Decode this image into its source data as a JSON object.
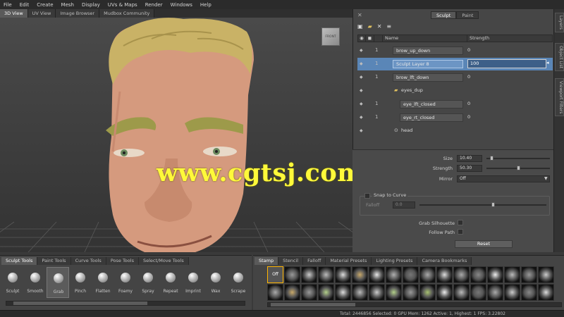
{
  "menubar": [
    "File",
    "Edit",
    "Create",
    "Mesh",
    "Display",
    "UVs & Maps",
    "Render",
    "Windows",
    "Help"
  ],
  "viewport_tabs": [
    {
      "label": "3D View",
      "active": true
    },
    {
      "label": "UV View",
      "active": false
    },
    {
      "label": "Image Browser",
      "active": false
    },
    {
      "label": "Mudbox Community",
      "active": false
    }
  ],
  "view_cube": "FRONT",
  "watermark": "www.cgtsj.com",
  "panel_tabs": [
    {
      "label": "Sculpt",
      "active": true
    },
    {
      "label": "Paint",
      "active": false
    }
  ],
  "layers": {
    "header": [
      "Name",
      "Strength"
    ],
    "rows": [
      {
        "name": "brow_up_down",
        "value": "0",
        "indent": 0,
        "selected": false,
        "lock": "1"
      },
      {
        "name": "Sculpt Layer 8",
        "value": "100",
        "indent": 0,
        "selected": true,
        "lock": "1"
      },
      {
        "name": "brow_lft_down",
        "value": "0",
        "indent": 0,
        "selected": false,
        "lock": "1"
      },
      {
        "name": "eyes_dup",
        "value": "",
        "indent": 0,
        "selected": false,
        "lock": "",
        "group": true
      },
      {
        "name": "eye_lft_closed",
        "value": "0",
        "indent": 1,
        "selected": false,
        "lock": "1"
      },
      {
        "name": "eye_rt_closed",
        "value": "0",
        "indent": 1,
        "selected": false,
        "lock": "1"
      },
      {
        "name": "head",
        "value": "",
        "indent": 0,
        "selected": false,
        "lock": "",
        "base": true
      }
    ]
  },
  "props": {
    "size_label": "Size",
    "size_value": "10.40",
    "size_level": 0.05,
    "strength_label": "Strength",
    "strength_value": "50.30",
    "strength_level": 0.5,
    "mirror_label": "Mirror",
    "mirror_value": "Off",
    "snap_label": "Snap to Curve",
    "falloff_label": "Falloff",
    "falloff_value": "0.0",
    "grab_label": "Grab Silhouette",
    "follow_label": "Follow Path",
    "reset_label": "Reset"
  },
  "tool_tabs": [
    {
      "label": "Sculpt Tools",
      "active": true
    },
    {
      "label": "Paint Tools",
      "active": false
    },
    {
      "label": "Curve Tools",
      "active": false
    },
    {
      "label": "Pose Tools",
      "active": false
    },
    {
      "label": "Select/Move Tools",
      "active": false
    }
  ],
  "tools": [
    {
      "label": "Sculpt",
      "active": false
    },
    {
      "label": "Smooth",
      "active": false
    },
    {
      "label": "Grab",
      "active": true
    },
    {
      "label": "Pinch",
      "active": false
    },
    {
      "label": "Flatten",
      "active": false
    },
    {
      "label": "Foamy",
      "active": false
    },
    {
      "label": "Spray",
      "active": false
    },
    {
      "label": "Repeat",
      "active": false
    },
    {
      "label": "Imprint",
      "active": false
    },
    {
      "label": "Wax",
      "active": false
    },
    {
      "label": "Scrape",
      "active": false
    }
  ],
  "stamp_tabs": [
    {
      "label": "Stamp",
      "active": true
    },
    {
      "label": "Stencil",
      "active": false
    },
    {
      "label": "Falloff",
      "active": false
    },
    {
      "label": "Material Presets",
      "active": false
    },
    {
      "label": "Lighting Presets",
      "active": false
    },
    {
      "label": "Camera Bookmarks",
      "active": false
    }
  ],
  "stamp_off": "Off",
  "status_text": "Total: 2446856  Selected: 0 GPU Mem: 1262  Active: 1, Highest: 1  FPS: 3.22802",
  "right_side_tabs": [
    "Object List",
    "Viewport Filters"
  ]
}
